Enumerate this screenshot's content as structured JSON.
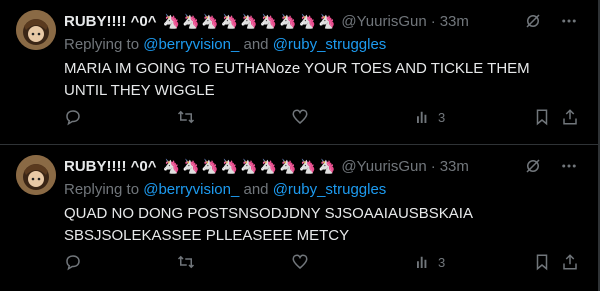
{
  "tweets": [
    {
      "display_name": "RUBY!!!! ^0^",
      "emojis": "🦄🦄🦄🦄🦄🦄🦄🦄🦄",
      "handle": "@YuurisGun",
      "separator": "·",
      "time": "33m",
      "replying_prefix": "Replying to",
      "mention_1": "@berryvision_",
      "replying_and": "and",
      "mention_2": "@ruby_struggles",
      "text": "MARIA IM GOING TO EUTHANoze YOUR TOES AND TICKLE THEM UNTIL THEY WIGGLE",
      "views": "3"
    },
    {
      "display_name": "RUBY!!!! ^0^",
      "emojis": "🦄🦄🦄🦄🦄🦄🦄🦄🦄",
      "handle": "@YuurisGun",
      "separator": "·",
      "time": "33m",
      "replying_prefix": "Replying to",
      "mention_1": "@berryvision_",
      "replying_and": "and",
      "mention_2": "@ruby_struggles",
      "text": "QUAD NO DONG POSTSNSODJDNY SJSOAAIAUSBSKAIA SBSJSOLEKASSEE PLLEASEEE METCY",
      "views": "3"
    }
  ],
  "icons": {
    "grok": "grok-icon",
    "more": "more-icon",
    "reply": "reply-icon",
    "retweet": "retweet-icon",
    "like": "heart-icon",
    "views": "views-icon",
    "bookmark": "bookmark-icon",
    "share": "share-icon"
  },
  "colors": {
    "background": "#000000",
    "text": "#e7e9ea",
    "muted": "#71767b",
    "link": "#1d9bf0",
    "divider": "#2f3336"
  }
}
